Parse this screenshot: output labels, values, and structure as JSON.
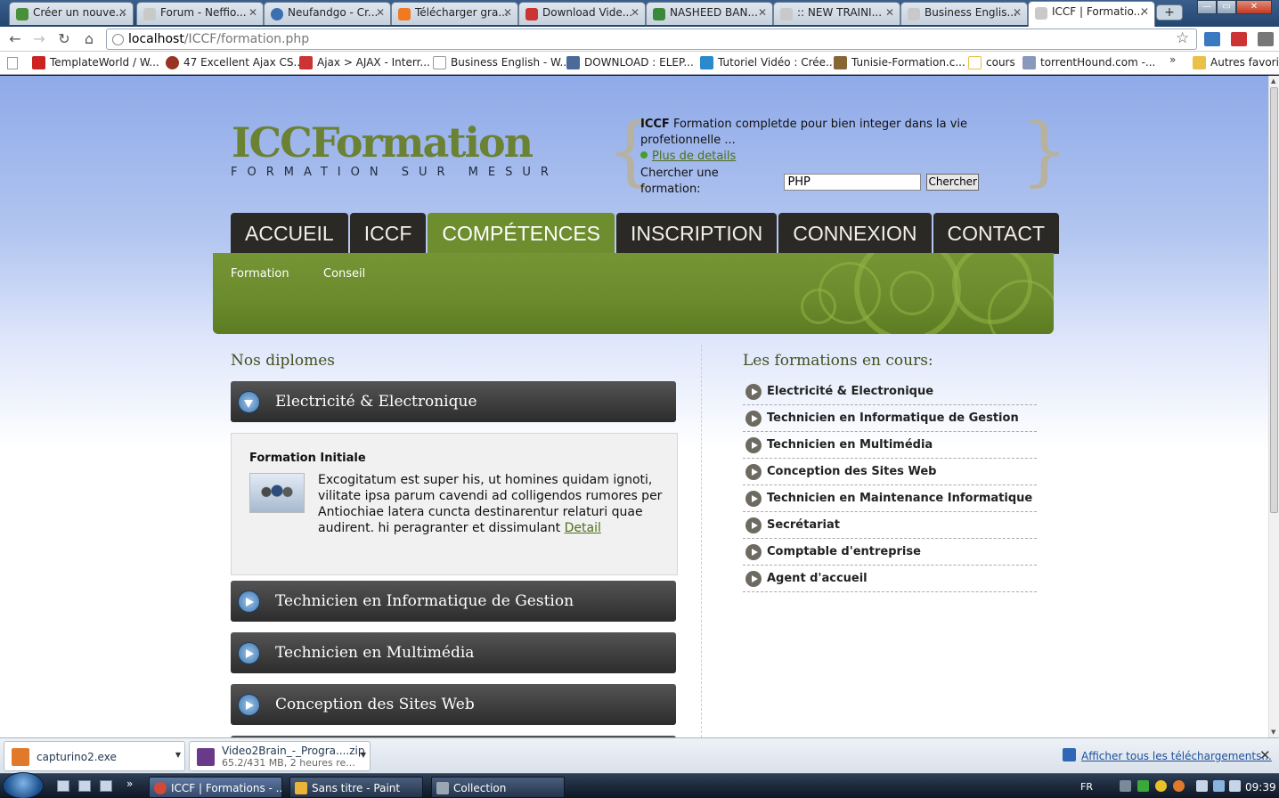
{
  "browser": {
    "tabs": [
      {
        "label": "Créer un nouve...",
        "icon": "site-icon",
        "color": "#4a8f3a"
      },
      {
        "label": "Forum - Neffio...",
        "icon": "page-icon",
        "color": "#c9c9c9"
      },
      {
        "label": "Neufandgo - Cr...",
        "icon": "globe-icon",
        "color": "#3a6fb0"
      },
      {
        "label": "Télécharger gra...",
        "icon": "blogger-icon",
        "color": "#f07a22"
      },
      {
        "label": "Download Vide...",
        "icon": "video-icon",
        "color": "#cc3333"
      },
      {
        "label": "NASHEED BAN...",
        "icon": "n-icon",
        "color": "#3b8a3b"
      },
      {
        "label": ":: NEW TRAINI...",
        "icon": "page-icon",
        "color": "#c9c9c9"
      },
      {
        "label": "Business Englis...",
        "icon": "page-icon",
        "color": "#c9c9c9"
      },
      {
        "label": "ICCF | Formatio...",
        "icon": "page-icon",
        "color": "#c9c9c9",
        "active": true
      }
    ],
    "new_tab_label": "+",
    "url_host": "localhost",
    "url_path": "/ICCF/formation.php",
    "bookmarks": [
      {
        "label": "TemplateWorld / W...",
        "color": "#cc2222"
      },
      {
        "label": "47 Excellent Ajax CS...",
        "color": "#993322"
      },
      {
        "label": "Ajax > AJAX - Interr...",
        "color": "#cc3333"
      },
      {
        "label": "Business English - W...",
        "color": "#d0d0d0"
      },
      {
        "label": "DOWNLOAD : ELEP...",
        "color": "#4a6a9a"
      },
      {
        "label": "Tutoriel Vidéo : Crée...",
        "color": "#2a8acb"
      },
      {
        "label": "Tunisie-Formation.c...",
        "color": "#886633"
      },
      {
        "label": "cours",
        "color": "#e8c04a"
      },
      {
        "label": "torrentHound.com -...",
        "color": "#8899bb"
      }
    ],
    "bookmarks_more": "»",
    "other_bookmarks": "Autres favoris"
  },
  "site": {
    "logo": "ICCFormation",
    "tagline": "FORMATION SUR MESUR",
    "info_bold": "ICCF",
    "info_text": " Formation completde pour bien integer dans la vie profetionnelle ...",
    "more_link": "Plus de details",
    "search_label": "Chercher une formation:",
    "search_value": "PHP",
    "search_button": "Chercher",
    "menu": [
      "ACCUEIL",
      "ICCF",
      "COMPÉTENCES",
      "INSCRIPTION",
      "CONNEXION",
      "CONTACT"
    ],
    "active_menu_index": 2,
    "submenu": [
      "Formation",
      "Conseil"
    ]
  },
  "left": {
    "heading": "Nos diplomes",
    "accordion": [
      "Electricité & Electronique",
      "Technicien en Informatique de Gestion",
      "Technicien en Multimédia",
      "Conception des Sites Web"
    ],
    "panel_title": "Formation Initiale",
    "panel_text": "Excogitatum est super his, ut homines quidam ignoti, vilitate ipsa parum cavendi ad colligendos rumores per Antiochiae latera cuncta destinarentur relaturi quae audirent. hi peragranter et dissimulant",
    "panel_link": "Detail"
  },
  "right": {
    "heading": "Les formations en cours:",
    "items": [
      "Electricité & Electronique",
      "Technicien en Informatique de Gestion",
      "Technicien en Multimédia",
      "Conception des Sites Web",
      "Technicien en Maintenance Informatique",
      "Secrétariat",
      "Comptable d'entreprise",
      "Agent d'accueil"
    ]
  },
  "downloads": {
    "items": [
      {
        "name": "capturino2.exe",
        "sub": ""
      },
      {
        "name": "Video2Brain_-_Progra....zip",
        "sub": "65.2/431 MB, 2 heures re..."
      }
    ],
    "show_all": "Afficher tous les téléchargements..."
  },
  "taskbar": {
    "tasks": [
      "ICCF | Formations - ...",
      "Sans titre - Paint",
      "Collection"
    ],
    "language": "FR",
    "clock": "09:39"
  }
}
